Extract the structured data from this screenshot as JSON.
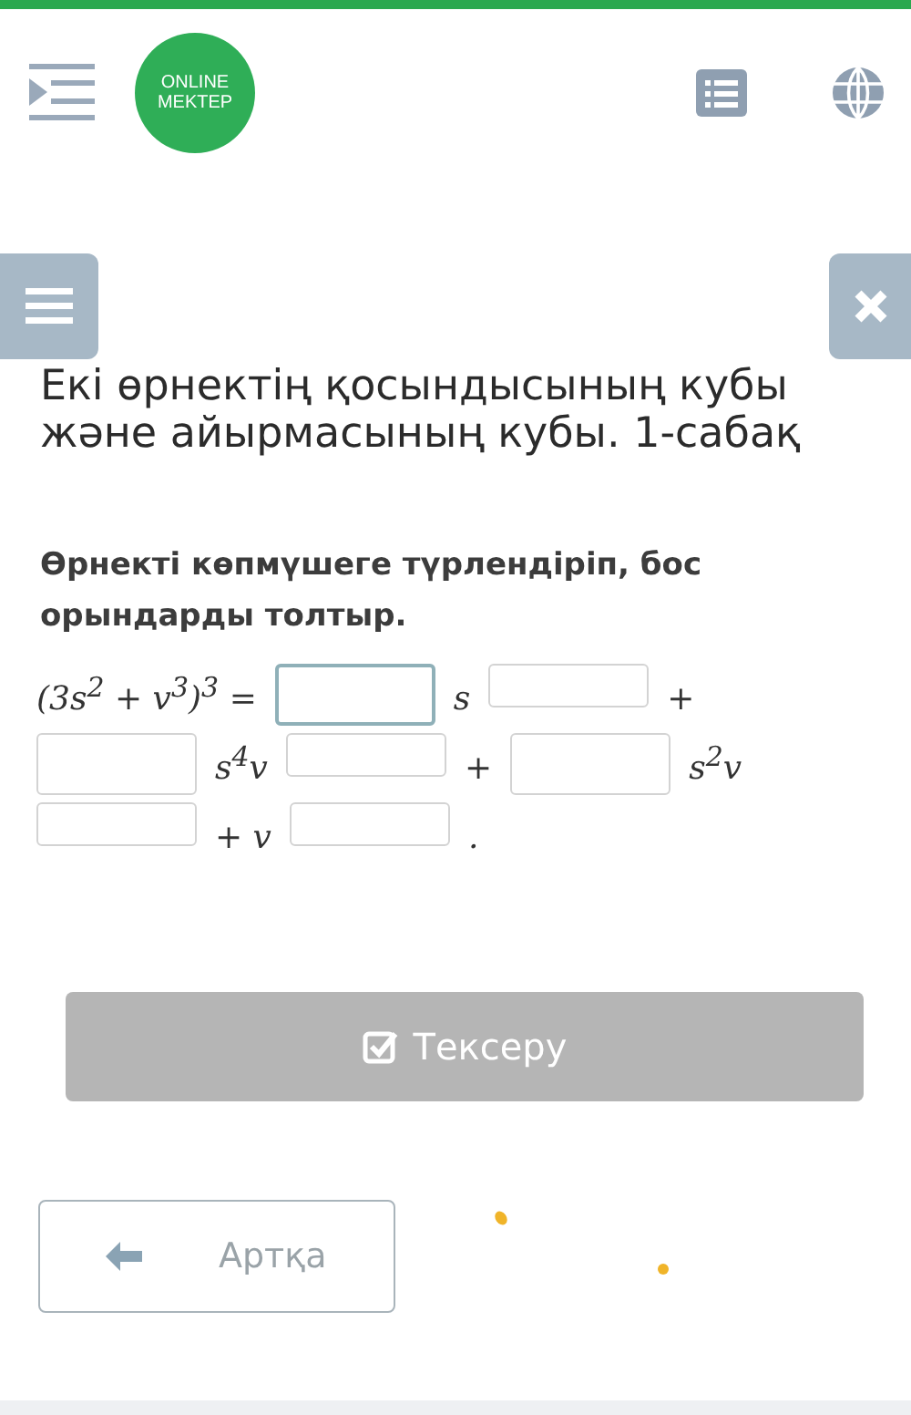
{
  "header": {
    "logo_line_1": "ONLINE",
    "logo_line_2": "MEKTEP"
  },
  "lesson_title": "Екі өрнектің қосындысының кубы және айырмасының кубы. 1-сабақ",
  "task": {
    "prompt": "Өрнекті көпмүшеге түрлендіріп, бос орындарды толтыр.",
    "equation_rows": [
      [
        {
          "kind": "text",
          "text": "(3s$^{2}$ + v$^{3}$)$^{3}$ ="
        },
        {
          "kind": "blank",
          "raised": false,
          "focused": true
        },
        {
          "kind": "text",
          "text": "s"
        },
        {
          "kind": "blank",
          "raised": true,
          "focused": false
        },
        {
          "kind": "text",
          "text": "+"
        }
      ],
      [
        {
          "kind": "blank",
          "raised": false,
          "focused": false
        },
        {
          "kind": "text",
          "text": "s$^{4}$v"
        },
        {
          "kind": "blank",
          "raised": true,
          "focused": false
        },
        {
          "kind": "text",
          "text": "+"
        },
        {
          "kind": "blank",
          "raised": false,
          "focused": false
        },
        {
          "kind": "text",
          "text": "s$^{2}$v"
        }
      ],
      [
        {
          "kind": "blank",
          "raised": true,
          "focused": false
        },
        {
          "kind": "text",
          "text": "+ v"
        },
        {
          "kind": "blank",
          "raised": true,
          "focused": false
        },
        {
          "kind": "text",
          "text": "."
        }
      ]
    ]
  },
  "check_button": {
    "label": "Тексеру",
    "disabled": true
  },
  "back_button": {
    "label": "Артқа"
  }
}
